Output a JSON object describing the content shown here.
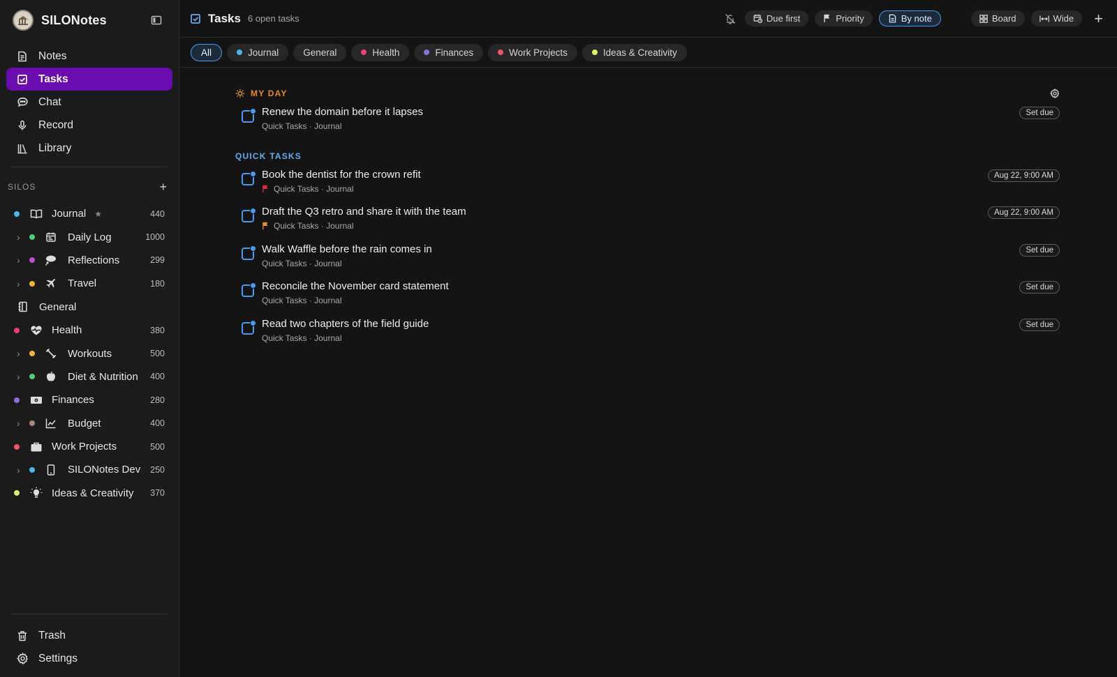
{
  "app": {
    "name": "SILONotes"
  },
  "nav": [
    {
      "label": "Notes",
      "icon": "document-icon"
    },
    {
      "label": "Tasks",
      "icon": "checkbox-icon",
      "active": true
    },
    {
      "label": "Chat",
      "icon": "chat-bubble-icon"
    },
    {
      "label": "Record",
      "icon": "microphone-icon"
    },
    {
      "label": "Library",
      "icon": "books-icon"
    }
  ],
  "silos": {
    "header": "SILOS",
    "items": [
      {
        "label": "Journal",
        "count": "440",
        "color": "#4ab6f0",
        "icon": "open-book-icon",
        "star": "★"
      },
      {
        "label": "Daily Log",
        "count": "1000",
        "color": "#4ccf7a",
        "icon": "calendar-icon",
        "chevron": "›"
      },
      {
        "label": "Reflections",
        "count": "299",
        "color": "#c24bd8",
        "icon": "thought-bubble-icon",
        "chevron": "›"
      },
      {
        "label": "Travel",
        "count": "180",
        "color": "#f2b535",
        "icon": "airplane-icon",
        "chevron": "›"
      },
      {
        "label": "General",
        "icon": "notebook-icon"
      },
      {
        "label": "Health",
        "count": "380",
        "color": "#ee3f7a",
        "icon": "heart-pulse-icon"
      },
      {
        "label": "Workouts",
        "count": "500",
        "color": "#f2b535",
        "icon": "dumbbell-icon",
        "chevron": "›"
      },
      {
        "label": "Diet & Nutrition",
        "count": "400",
        "color": "#4ccf7a",
        "icon": "apple-icon",
        "chevron": "›"
      },
      {
        "label": "Finances",
        "count": "280",
        "color": "#8a6fe0",
        "icon": "money-icon"
      },
      {
        "label": "Budget",
        "count": "400",
        "color": "#a88580",
        "icon": "line-chart-icon",
        "chevron": "›"
      },
      {
        "label": "Work Projects",
        "count": "500",
        "color": "#f0566a",
        "icon": "briefcase-icon"
      },
      {
        "label": "SILONotes Dev",
        "count": "250",
        "color": "#4ab6f0",
        "icon": "phone-icon",
        "chevron": "›"
      },
      {
        "label": "Ideas & Creativity",
        "count": "370",
        "color": "#d9f06a",
        "icon": "lightbulb-icon"
      }
    ]
  },
  "bottom_nav": [
    {
      "label": "Trash",
      "icon": "trash-icon"
    },
    {
      "label": "Settings",
      "icon": "gear-icon"
    }
  ],
  "topbar": {
    "title": "Tasks",
    "subtitle": "6 open tasks",
    "buttons": {
      "due_first": "Due first",
      "priority": "Priority",
      "by_note": "By note",
      "board": "Board",
      "wide": "Wide"
    },
    "plus": "+"
  },
  "filters": [
    {
      "label": "All"
    },
    {
      "label": "Journal",
      "color": "#4ab6f0"
    },
    {
      "label": "General"
    },
    {
      "label": "Health",
      "color": "#ee3f7a"
    },
    {
      "label": "Finances",
      "color": "#8a6fe0"
    },
    {
      "label": "Work Projects",
      "color": "#f0566a"
    },
    {
      "label": "Ideas & Creativity",
      "color": "#d9f06a"
    }
  ],
  "sections": {
    "my_day": {
      "heading": "MY DAY",
      "tasks": [
        {
          "title": "Renew the domain before it lapses",
          "meta": "Quick Tasks · Journal",
          "due": "Set due"
        }
      ]
    },
    "quick_tasks": {
      "heading": "QUICK TASKS",
      "tasks": [
        {
          "title": "Book the dentist for the crown refit",
          "meta": "Quick Tasks · Journal",
          "due": "Aug 22, 9:00 AM",
          "flag_color": "#e0303c"
        },
        {
          "title": "Draft the Q3 retro and share it with the team",
          "meta": "Quick Tasks · Journal",
          "due": "Aug 22, 9:00 AM",
          "flag_color": "#e8912b"
        },
        {
          "title": "Walk Waffle before the rain comes in",
          "meta": "Quick Tasks · Journal",
          "due": "Set due"
        },
        {
          "title": "Reconcile the November card statement",
          "meta": "Quick Tasks · Journal",
          "due": "Set due"
        },
        {
          "title": "Read two chapters of the field guide",
          "meta": "Quick Tasks · Journal",
          "due": "Set due"
        }
      ]
    }
  }
}
